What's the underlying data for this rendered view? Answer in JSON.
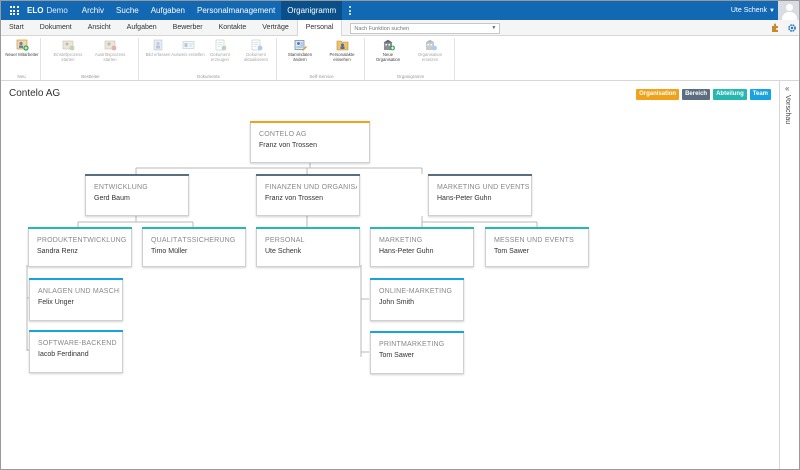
{
  "topnav": {
    "brand_bold": "ELO",
    "brand_rest": "Demo",
    "items": [
      "Archiv",
      "Suche",
      "Aufgaben",
      "Personalmanagement",
      "Organigramm"
    ],
    "active": "Organigramm",
    "user": "Ute Schenk"
  },
  "tabs": {
    "items": [
      "Start",
      "Dokument",
      "Ansicht",
      "Aufgaben",
      "Bewerber",
      "Kontakte",
      "Verträge",
      "Personal"
    ],
    "active": "Personal",
    "search_placeholder": "Nach Funktion suchen"
  },
  "ribbon": {
    "groups": [
      {
        "label": "Neu",
        "buttons": [
          "Neuer Mitarbeiter"
        ]
      },
      {
        "label": "Bestleiter",
        "buttons": [
          "Einstellprozess starten",
          "Austrittsprozess starten"
        ]
      },
      {
        "label": "Dokumente",
        "buttons": [
          "Bild erfassen",
          "Ausweis erstellen",
          "Dokument erzeugen",
          "Dokument aktualisieren"
        ]
      },
      {
        "label": "Self-Service",
        "buttons": [
          "Stammdaten ändern",
          "Personalakte einsehen"
        ]
      },
      {
        "label": "Organigramm",
        "buttons": [
          "Neue Organisation",
          "Organisation ersetzen"
        ]
      }
    ]
  },
  "page": {
    "title": "Contelo AG"
  },
  "legend": [
    {
      "label": "Organisation",
      "color": "#f0a21b"
    },
    {
      "label": "Bereich",
      "color": "#5a6e80"
    },
    {
      "label": "Abteilung",
      "color": "#26b8b0"
    },
    {
      "label": "Team",
      "color": "#18a3e0"
    }
  ],
  "preview_label": "Vorschau",
  "org": {
    "root": {
      "name": "CONTELO AG",
      "person": "Franz von Trossen",
      "type": "Organisation"
    },
    "areas": [
      {
        "name": "ENTWICKLUNG",
        "person": "Gerd Baum",
        "type": "Bereich"
      },
      {
        "name": "FINANZEN UND ORGANISATION",
        "person": "Franz von Trossen",
        "type": "Bereich"
      },
      {
        "name": "MARKETING UND EVENTS",
        "person": "Hans-Peter Guhn",
        "type": "Bereich"
      }
    ],
    "departments": [
      {
        "name": "PRODUKTENTWICKLUNG",
        "person": "Sandra Renz",
        "type": "Abteilung"
      },
      {
        "name": "QUALITÄTSSICHERUNG",
        "person": "Timo Müller",
        "type": "Abteilung"
      },
      {
        "name": "PERSONAL",
        "person": "Ute Schenk",
        "type": "Abteilung"
      },
      {
        "name": "MARKETING",
        "person": "Hans-Peter Guhn",
        "type": "Abteilung"
      },
      {
        "name": "MESSEN UND EVENTS",
        "person": "Tom Sawer",
        "type": "Abteilung"
      }
    ],
    "teams": [
      {
        "name": "ANLAGEN UND MASCHINEN",
        "person": "Felix Unger",
        "type": "Team"
      },
      {
        "name": "SOFTWARE-BACKEND",
        "person": "Iacob Ferdinand",
        "type": "Team"
      },
      {
        "name": "ONLINE-MARKETING",
        "person": "John Smith",
        "type": "Team"
      },
      {
        "name": "PRINTMARKETING",
        "person": "Tom Sawer",
        "type": "Team"
      }
    ]
  }
}
